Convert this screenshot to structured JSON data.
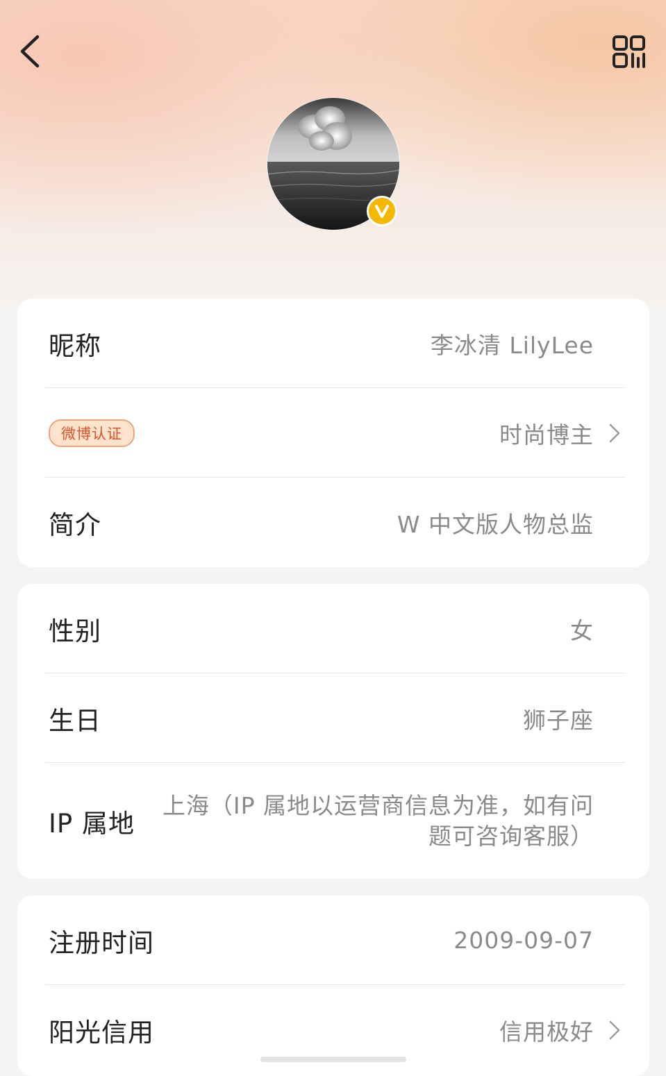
{
  "profile": {
    "nickname_label": "昵称",
    "nickname_value": "李冰清 LilyLee",
    "verify_tag": "微博认证",
    "verify_value": "时尚博主",
    "bio_label": "简介",
    "bio_value": "W 中文版人物总监"
  },
  "personal": {
    "gender_label": "性别",
    "gender_value": "女",
    "birthday_label": "生日",
    "birthday_value": "狮子座",
    "ip_label": "IP 属地",
    "ip_value": "上海（IP 属地以运营商信息为准，如有问题可咨询客服）"
  },
  "account": {
    "register_label": "注册时间",
    "register_value": "2009-09-07",
    "credit_label": "阳光信用",
    "credit_value": "信用极好"
  },
  "icons": {
    "back": "chevron-left-icon",
    "qr": "qr-code-icon",
    "verified": "verified-v-icon",
    "arrow": "chevron-right-icon"
  },
  "colors": {
    "verified_badge": "#f5b800",
    "tag_text": "#d9542a",
    "tag_bg": "#fde2cc"
  }
}
